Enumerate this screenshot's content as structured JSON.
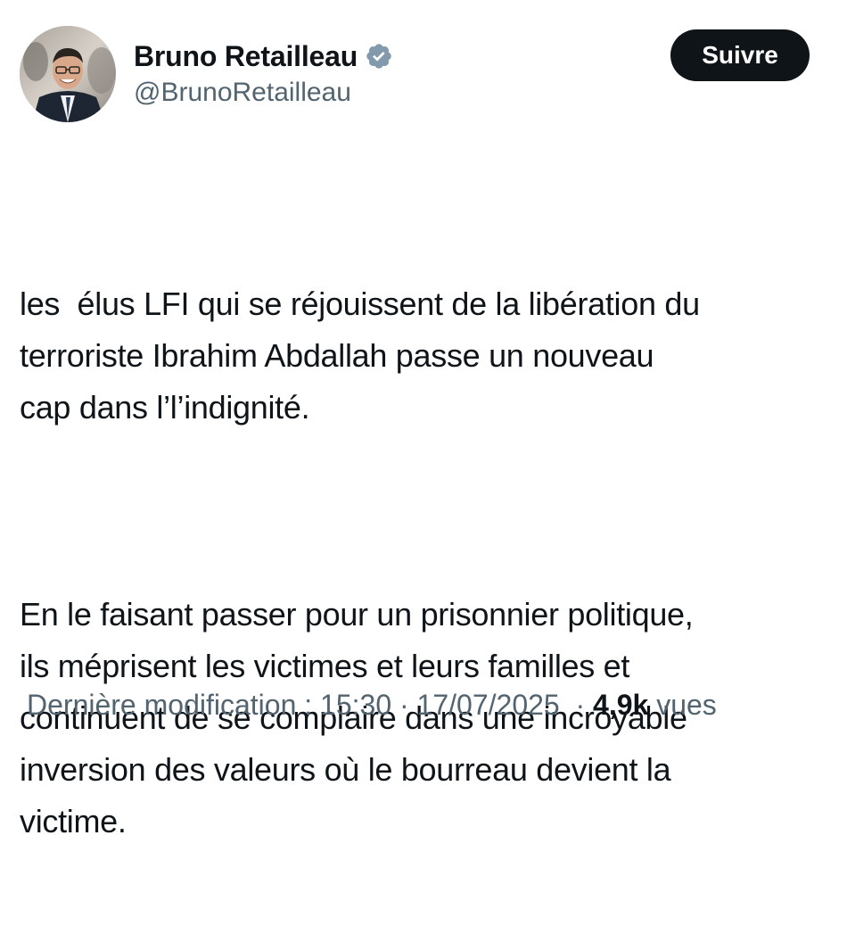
{
  "author": {
    "display_name": "Bruno Retailleau",
    "handle": "@BrunoRetailleau",
    "verified": true,
    "avatar": "profile-photo"
  },
  "follow_button": {
    "label": "Suivre"
  },
  "tweet": {
    "paragraphs": [
      "les  élus LFI qui se réjouissent de la libération du\nterroriste Ibrahim Abdallah passe un nouveau\ncap dans l’l’indignité.",
      "En le faisant passer pour un prisonnier politique,\nils méprisent les victimes et leurs familles et\ncontinuent de se complaire dans une incroyable\ninversion des valeurs où le bourreau devient la\nvictime."
    ]
  },
  "meta": {
    "edit_label": "Dernière modification : 15:30",
    "separator": " · ",
    "date": "17/07/2025",
    "separator2": "  · ",
    "views_count": "4,9k",
    "views_label": " vues"
  },
  "colors": {
    "text": "#0f1419",
    "secondary": "#536471",
    "verified_badge": "#829aab",
    "button_bg": "#0f1419",
    "button_text": "#ffffff"
  }
}
